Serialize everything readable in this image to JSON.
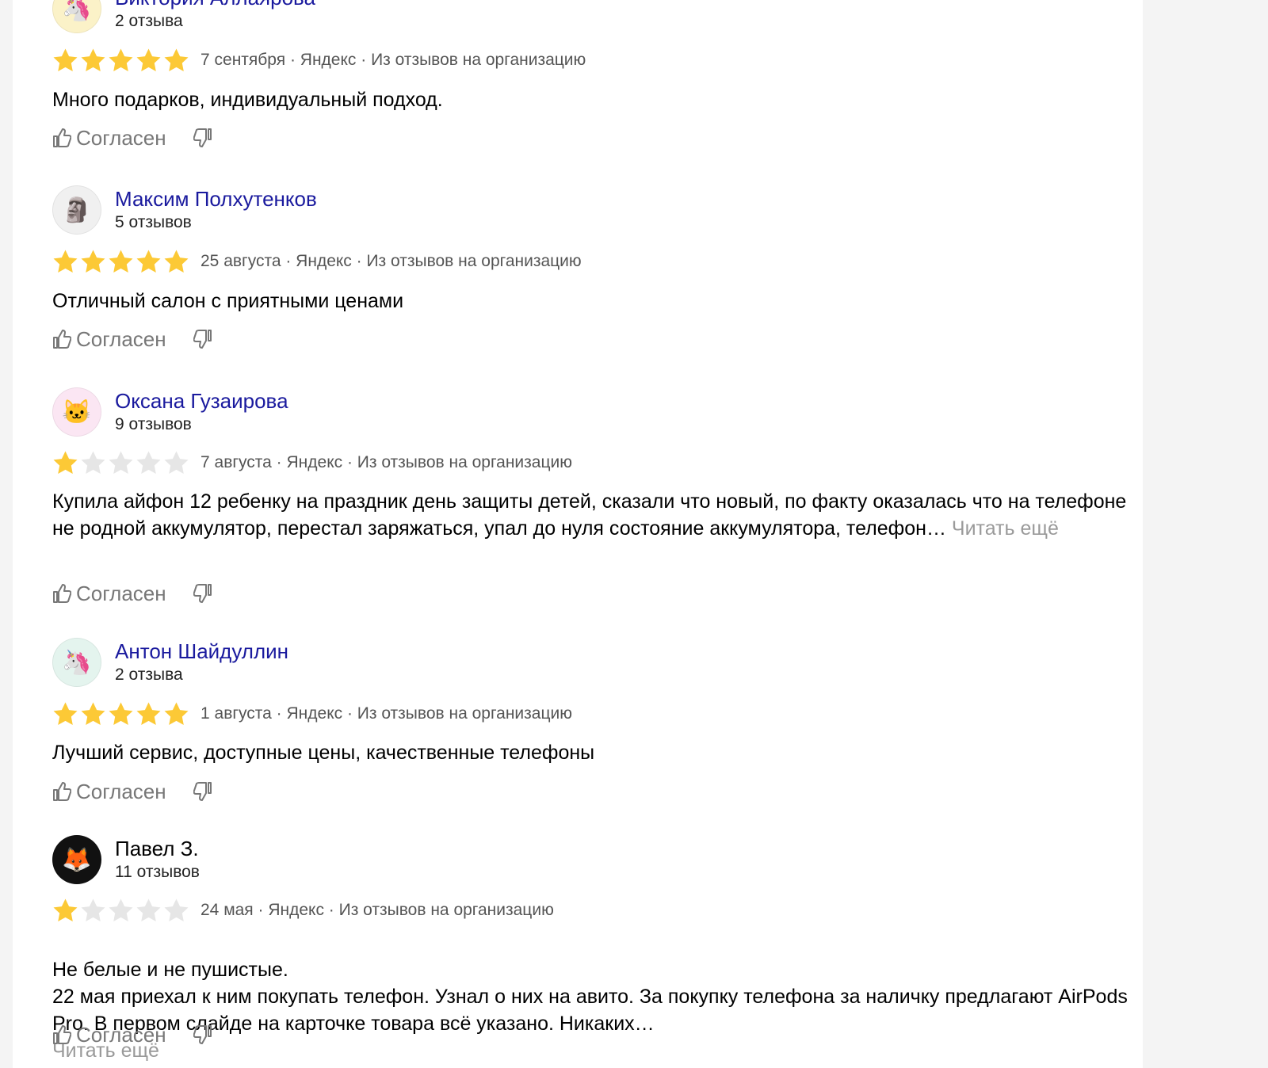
{
  "reviews": [
    {
      "author": "Виктория Аллаярова",
      "count": "2 отзыва",
      "avatar_emoji": "🦄",
      "avatar_bg": "#fbf2c8",
      "rating": 5,
      "date": "7 сентября",
      "source": "Яндекс",
      "origin": "Из отзывов на организацию",
      "text": "Много подарков, индивидуальный подход.",
      "read_more": "",
      "agree": "Согласен"
    },
    {
      "author": "Максим Полхутенков",
      "count": "5 отзывов",
      "avatar_emoji": "🗿",
      "avatar_bg": "#f0f0f0",
      "rating": 5,
      "date": "25 августа",
      "source": "Яндекс",
      "origin": "Из отзывов на организацию",
      "text": "Отличный салон с приятными ценами",
      "read_more": "",
      "agree": "Согласен"
    },
    {
      "author": "Оксана Гузаирова",
      "count": "9 отзывов",
      "avatar_emoji": "🐱",
      "avatar_bg": "#fbe6f3",
      "rating": 1,
      "date": "7 августа",
      "source": "Яндекс",
      "origin": "Из отзывов на организацию",
      "text": "Купила айфон 12 ребенку на праздник день защиты детей, сказали что новый, по факту оказалась что на телефоне не родной аккумулятор, перестал заряжаться, упал до нуля состояние аккумулятора, телефон…",
      "read_more": "Читать ещё",
      "agree": "Согласен"
    },
    {
      "author": "Антон Шайдуллин",
      "count": "2 отзыва",
      "avatar_emoji": "🦄",
      "avatar_bg": "#e4f4ee",
      "rating": 5,
      "date": "1 августа",
      "source": "Яндекс",
      "origin": "Из отзывов на организацию",
      "text": "Лучший сервис, доступные цены, качественные телефоны",
      "read_more": "",
      "agree": "Согласен"
    },
    {
      "author": "Павел З.",
      "count": "11 отзывов",
      "avatar_emoji": "🦊",
      "avatar_bg": "#111111",
      "rating": 1,
      "date": "24 мая",
      "source": "Яндекс",
      "origin": "Из отзывов на организацию",
      "text": "Не белые и не пушистые.\n22 мая приехал к ним покупать телефон. Узнал о них на авито. За покупку телефона за наличку предлагают AirPods Pro. В первом слайде на карточке товара всё указано. Никаких…",
      "read_more": "Читать ещё",
      "agree": "Согласен"
    }
  ],
  "star_colors": {
    "filled": "#fcc936",
    "empty": "#e6e6e6"
  },
  "link_color": "#1a1a9e"
}
